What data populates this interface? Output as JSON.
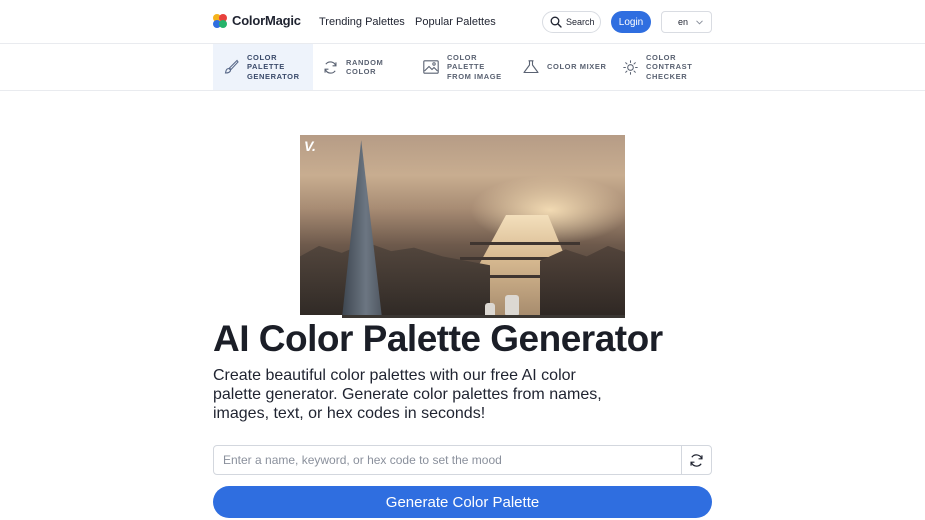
{
  "brand": {
    "name": "ColorMagic"
  },
  "nav": {
    "trending": "Trending Palettes",
    "popular": "Popular Palettes",
    "search": "Search",
    "login": "Login",
    "language": "en"
  },
  "tools": [
    {
      "label_lines": [
        "COLOR",
        "PALETTE",
        "GENERATOR"
      ],
      "icon": "brush-icon",
      "active": true
    },
    {
      "label_lines": [
        "RANDOM",
        "COLOR"
      ],
      "icon": "refresh-icon",
      "active": false
    },
    {
      "label_lines": [
        "COLOR",
        "PALETTE",
        "FROM IMAGE"
      ],
      "icon": "image-icon",
      "active": false
    },
    {
      "label_lines": [
        "COLOR MIXER"
      ],
      "icon": "flask-icon",
      "active": false
    },
    {
      "label_lines": [
        "COLOR",
        "CONTRAST",
        "CHECKER"
      ],
      "icon": "sun-icon",
      "active": false
    }
  ],
  "video": {
    "watermark": "V.",
    "progress": 0.13
  },
  "hero": {
    "title": "AI Color Palette Generator",
    "subtitle": "Create beautiful color palettes with our free AI color palette generator. Generate color palettes from names, images, text, or hex codes in seconds!"
  },
  "input": {
    "placeholder": "Enter a name, keyword, or hex code to set the mood",
    "value": ""
  },
  "generate_button": "Generate Color Palette",
  "colors": {
    "accent": "#2f6ee0",
    "active_tool_bg": "#eef3fb"
  }
}
